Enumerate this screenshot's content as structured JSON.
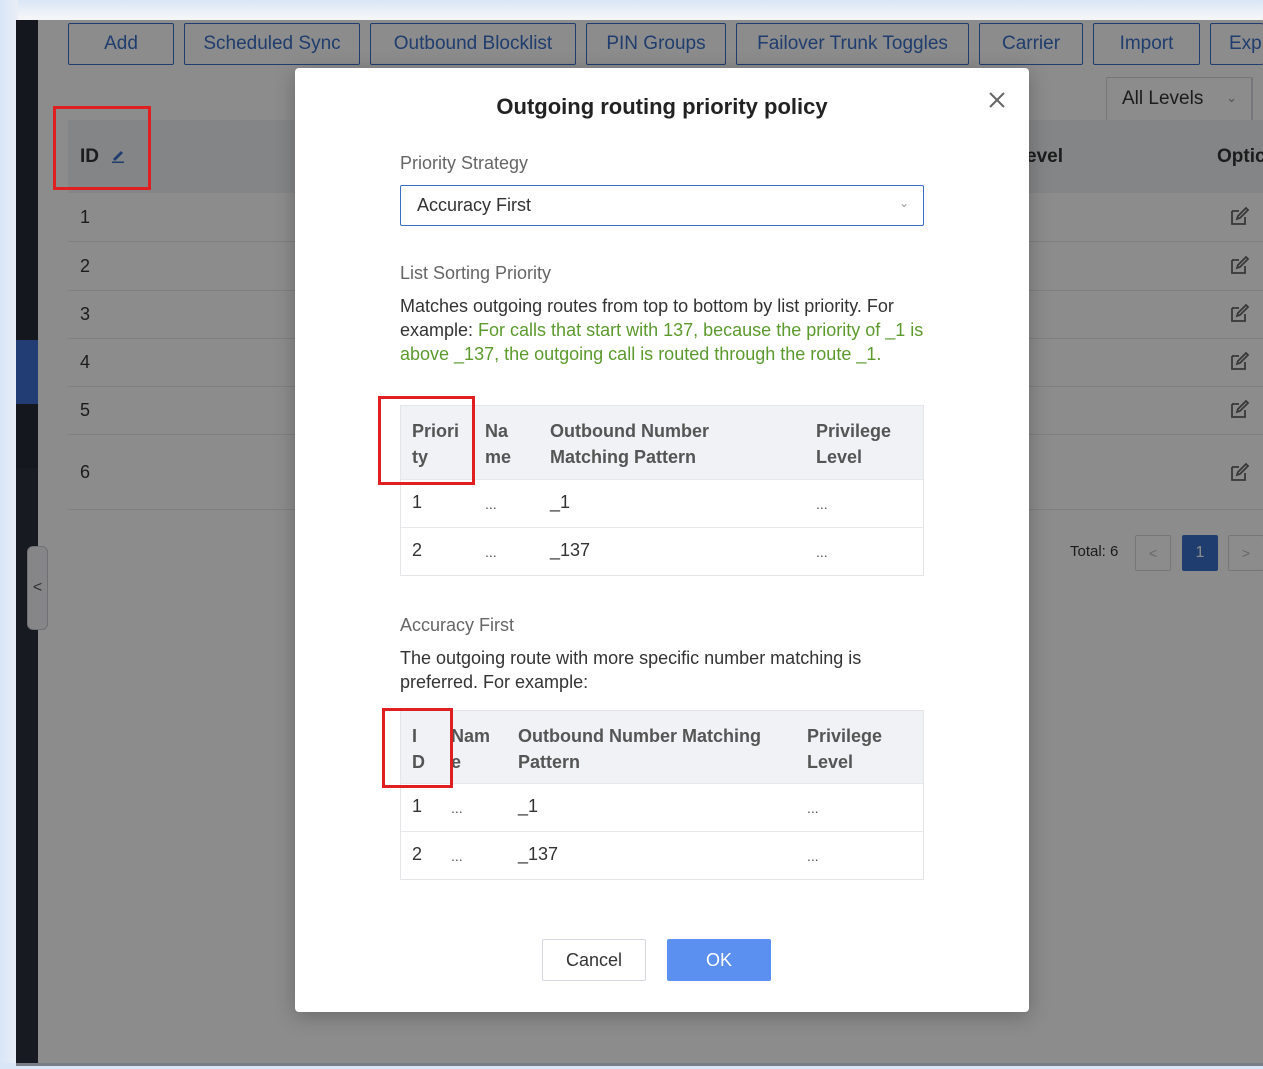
{
  "toolbar": {
    "add": "Add",
    "scheduled_sync": "Scheduled Sync",
    "outbound_blocklist": "Outbound Blocklist",
    "pin_groups": "PIN Groups",
    "failover_trunk_toggles": "Failover Trunk Toggles",
    "carrier": "Carrier",
    "import": "Import",
    "export": "Exp"
  },
  "filter": {
    "level_select": "All Levels"
  },
  "grid": {
    "col_id": "ID",
    "col_level": "evel",
    "col_options": "Optic",
    "row_ids": [
      "1",
      "2",
      "3",
      "4",
      "5",
      "6"
    ]
  },
  "pager": {
    "total": "Total: 6",
    "prev": "<",
    "current": "1",
    "next": ">"
  },
  "sidebar": {
    "collapse_glyph": "<"
  },
  "modal": {
    "title": "Outgoing routing priority policy",
    "close_glyph": "×",
    "strategy_label": "Priority Strategy",
    "strategy_value": "Accuracy First",
    "list_label": "List Sorting Priority",
    "list_desc": "Matches outgoing routes from top to bottom by list priority.",
    "list_example_prefix": "For example: ",
    "list_example_text": "For calls that start with 137, because the priority of _1 is above _137, the outgoing call is routed through the route _1.",
    "list_table": {
      "headers": [
        "Priori\nty",
        "Na\nme",
        "Outbound Number\nMatching Pattern",
        "Privilege\nLevel"
      ],
      "rows": [
        [
          "1",
          "...",
          "_1",
          "..."
        ],
        [
          "2",
          "...",
          "_137",
          "..."
        ]
      ]
    },
    "accuracy_label": "Accuracy First",
    "accuracy_desc": "The outgoing route with more specific number matching is preferred. For example:",
    "accuracy_table": {
      "headers": [
        "I\nD",
        "Nam\ne",
        "Outbound Number Matching\nPattern",
        "Privilege\nLevel"
      ],
      "rows": [
        [
          "1",
          "...",
          "_1",
          "..."
        ],
        [
          "2",
          "...",
          "_137",
          "..."
        ]
      ]
    },
    "cancel": "Cancel",
    "ok": "OK"
  },
  "colors": {
    "accent": "#3a6fc8",
    "ok_button": "#5b8ff0",
    "highlight_text": "#5c9a2e",
    "annotation_red": "#e02020"
  }
}
